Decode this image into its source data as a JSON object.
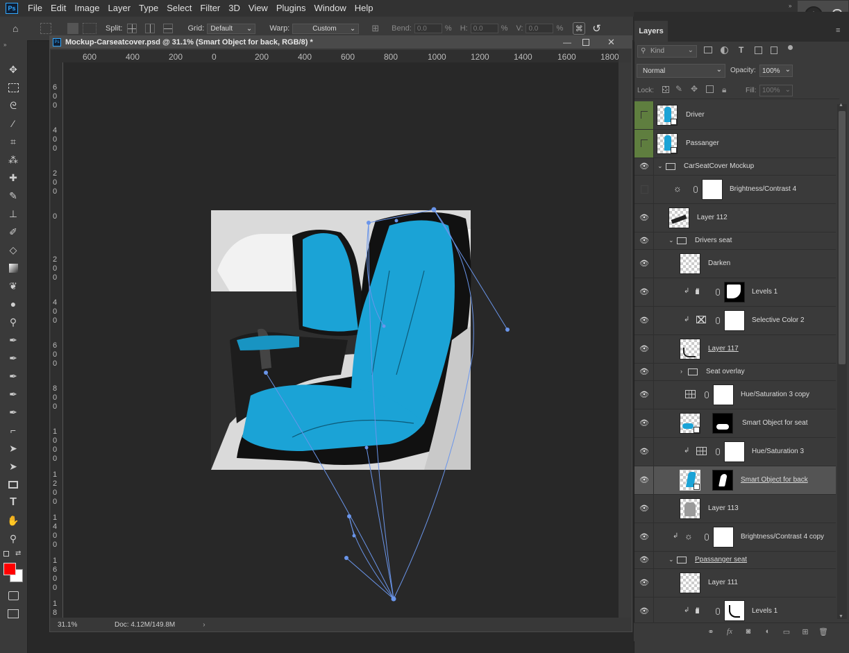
{
  "menu": {
    "items": [
      "File",
      "Edit",
      "Image",
      "Layer",
      "Type",
      "Select",
      "Filter",
      "3D",
      "View",
      "Plugins",
      "Window",
      "Help"
    ]
  },
  "logo": "Ps",
  "options": {
    "split_label": "Split:",
    "grid_label": "Grid:",
    "grid_value": "Default",
    "warp_label": "Warp:",
    "warp_value": "Custom",
    "bend_label": "Bend:",
    "bend_value": "0.0",
    "bend_unit": "%",
    "h_label": "H:",
    "h_value": "0.0",
    "h_unit": "%",
    "v_label": "V:",
    "v_value": "0.0",
    "v_unit": "%"
  },
  "document": {
    "title": "Mockup-Carseatcover.psd @ 31.1% (Smart Object for back, RGB/8) *",
    "zoom": "31.1%",
    "doc_size": "Doc: 4.12M/149.8M",
    "ruler_h": [
      "600",
      "400",
      "200",
      "0",
      "200",
      "400",
      "600",
      "800",
      "1000",
      "1200",
      "1400",
      "1600",
      "1800"
    ],
    "ruler_v": [
      "6\n0\n0",
      "4\n0\n0",
      "2\n0\n0",
      "0",
      "2\n0\n0",
      "4\n0\n0",
      "6\n0\n0",
      "8\n0\n0",
      "1\n0\n0\n0",
      "1\n2\n0\n0",
      "1\n4\n0\n0",
      "1\n6\n0\n0",
      "1\n8"
    ]
  },
  "layers_panel": {
    "tab": "Layers",
    "filter_kind": "Kind",
    "blend_mode": "Normal",
    "opacity_label": "Opacity:",
    "opacity_value": "100%",
    "lock_label": "Lock:",
    "fill_label": "Fill:",
    "fill_value": "100%",
    "layers": [
      {
        "name": "Driver",
        "kind": "smart-blue",
        "visible": false,
        "green": true
      },
      {
        "name": "Passanger",
        "kind": "smart-blue",
        "visible": false,
        "green": true
      },
      {
        "name": "CarSeatCover Mockup",
        "kind": "group",
        "visible": true
      },
      {
        "name": "Brightness/Contrast 4",
        "kind": "adjust-bc",
        "visible": false
      },
      {
        "name": "Layer 112",
        "kind": "pixel-dark",
        "visible": true
      },
      {
        "name": "Drivers seat",
        "kind": "group",
        "visible": true
      },
      {
        "name": "Darken",
        "kind": "pixel",
        "visible": true
      },
      {
        "name": "Levels 1",
        "kind": "adjust-levels",
        "visible": true
      },
      {
        "name": "Selective Color 2",
        "kind": "adjust-sc",
        "visible": true
      },
      {
        "name": "Layer 117",
        "kind": "pixel-dark",
        "visible": true
      },
      {
        "name": "Seat overlay",
        "kind": "group-closed",
        "visible": true
      },
      {
        "name": "Hue/Saturation 3 copy",
        "kind": "adjust-hs",
        "visible": true
      },
      {
        "name": "Smart Object for seat",
        "kind": "smart-seat",
        "visible": true
      },
      {
        "name": "Hue/Saturation 3",
        "kind": "adjust-hs-clip",
        "visible": true
      },
      {
        "name": "Smart Object for back",
        "kind": "smart-back",
        "visible": true,
        "selected": true
      },
      {
        "name": "Layer 113",
        "kind": "pixel-seat",
        "visible": true
      },
      {
        "name": "Brightness/Contrast 4 copy",
        "kind": "adjust-bc-clip",
        "visible": true
      },
      {
        "name": "Ppassanger seat",
        "kind": "group",
        "visible": true
      },
      {
        "name": "Layer 111",
        "kind": "pixel",
        "visible": true
      },
      {
        "name": "Levels 1",
        "kind": "adjust-levels-2",
        "visible": true
      }
    ]
  },
  "colors": {
    "foreground": "#ff0000",
    "background": "#ffffff",
    "seat": "#1ba3d6",
    "path": "#6a95ea"
  }
}
